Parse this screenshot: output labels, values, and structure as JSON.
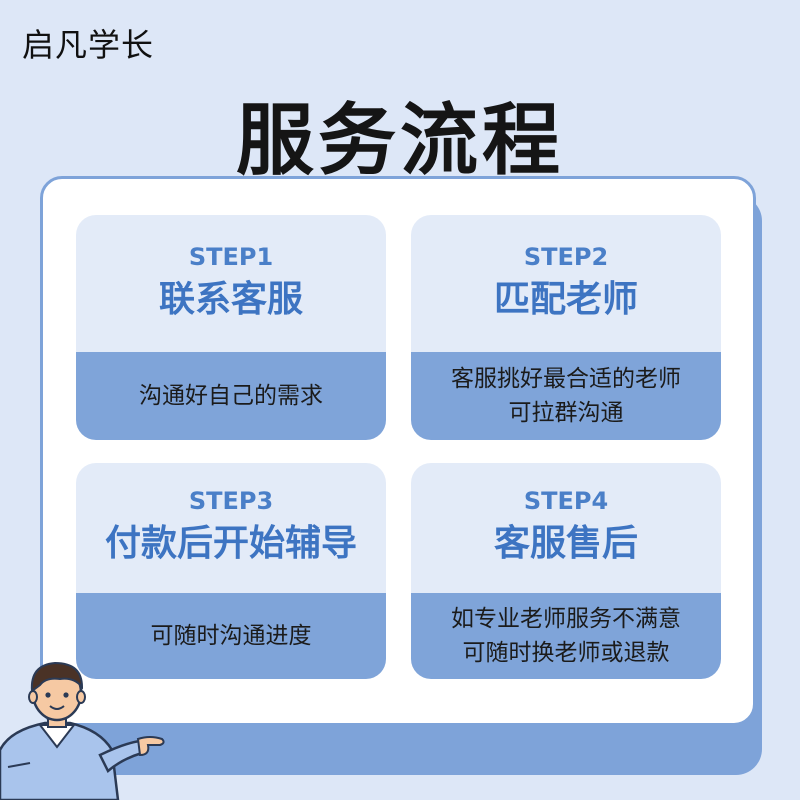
{
  "header": {
    "brand": "启凡学长",
    "title": "服务流程"
  },
  "steps": [
    {
      "step": "STEP1",
      "name": "联系客服",
      "desc": [
        "沟通好自己的需求"
      ]
    },
    {
      "step": "STEP2",
      "name": "匹配老师",
      "desc": [
        "客服挑好最合适的老师",
        "可拉群沟通"
      ]
    },
    {
      "step": "STEP3",
      "name": "付款后开始辅导",
      "desc": [
        "可随时沟通进度"
      ]
    },
    {
      "step": "STEP4",
      "name": "客服售后",
      "desc": [
        "如专业老师服务不满意",
        "可随时换老师或退款"
      ]
    }
  ],
  "colors": {
    "background": "#dde7f7",
    "accent": "#3d74c2",
    "card_light": "#e3ebf8",
    "card_dark": "#7fa4d9"
  },
  "mascot": {
    "icon": "pointing-teacher-icon"
  }
}
